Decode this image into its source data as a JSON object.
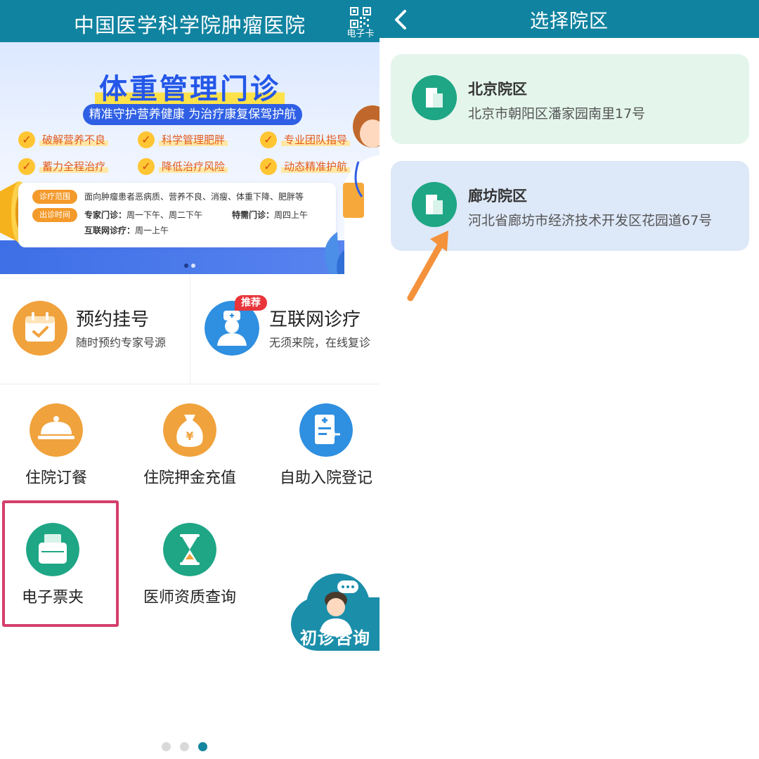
{
  "left_screen": {
    "header": {
      "title": "中国医学科学院肿瘤医院",
      "ecard_label": "电子卡"
    },
    "banner": {
      "headline": "体重管理门诊",
      "subtitle": "精准守护营养健康 为治疗康复保驾护航",
      "features": [
        "破解营养不良",
        "科学管理肥胖",
        "专业团队指导",
        "蓄力全程治疗",
        "降低治疗风险",
        "动态精准护航"
      ],
      "scope_tag": "诊疗范围",
      "scope_text": "面向肿瘤患者恶病质、营养不良、消瘦、体重下降、肥胖等",
      "time_tag": "出诊时间",
      "expert_label": "专家门诊：",
      "expert_time": "周一下午、周二下午",
      "special_label": "特需门诊：",
      "special_time": "周四上午",
      "online_label": "互联网诊疗：",
      "online_time": "周一上午",
      "carousel_active": 1,
      "carousel_total": 2
    },
    "services": [
      {
        "title": "预约挂号",
        "desc": "随时预约专家号源",
        "icon": "calendar-icon",
        "color": "#f0a23c"
      },
      {
        "title": "互联网诊疗",
        "desc": "无须来院，在线复诊",
        "icon": "doctor-icon",
        "color": "#2f8fe0",
        "badge": "推荐"
      }
    ],
    "grid": [
      {
        "label": "住院订餐",
        "icon": "meal-cloche-icon",
        "color": "#f0a23c"
      },
      {
        "label": "住院押金充值",
        "icon": "money-bag-icon",
        "color": "#f0a23c"
      },
      {
        "label": "自助入院登记",
        "icon": "admission-form-icon",
        "color": "#2f8fe0"
      },
      {
        "label": "电子票夹",
        "icon": "ticket-wallet-icon",
        "color": "#1ea685"
      },
      {
        "label": "医师资质查询",
        "icon": "hourglass-icon",
        "color": "#1ea685"
      }
    ],
    "consult_button": "初诊咨询",
    "page_indicator": {
      "total": 3,
      "active": 3
    },
    "highlight_color": "#d43f6a"
  },
  "right_screen": {
    "header": {
      "title": "选择院区",
      "back_icon": "chevron-left-icon"
    },
    "campuses": [
      {
        "name": "北京院区",
        "address": "北京市朝阳区潘家园南里17号",
        "bg": "#e4f5ec",
        "icon": "building-icon"
      },
      {
        "name": "廊坊院区",
        "address": "河北省廊坊市经济技术开发区花园道67号",
        "bg": "#dde8f8",
        "icon": "building-icon"
      }
    ],
    "arrow_color": "#f4913b"
  },
  "colors": {
    "header": "#1083a0",
    "accent_teal": "#1ea685",
    "accent_orange": "#f0a23c",
    "accent_blue": "#2f8fe0"
  }
}
